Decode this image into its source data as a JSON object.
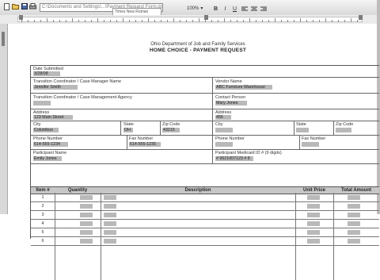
{
  "toolbar": {
    "path_text": "C:\\Documents and Settings\\...\\Payment Request Form.doc",
    "font_name": "Times New Roman",
    "zoom": "100%",
    "buttons": [
      "new-icon",
      "open-icon",
      "save-icon",
      "print-icon",
      "cut-icon",
      "copy-icon",
      "paste-icon",
      "undo-icon"
    ],
    "right_buttons": [
      "bold-icon",
      "italic-icon",
      "underline-icon",
      "align-left-icon",
      "align-center-icon",
      "align-right-icon",
      "bullets-icon",
      "indent-icon"
    ]
  },
  "document": {
    "agency_line": "Ohio Department of Job and Family Services",
    "title": "HOME CHOICE - PAYMENT REQUEST",
    "date_submitted_label": "Date Submitted",
    "date_submitted_value": "3/28/08",
    "coordinator_label": "Transition Coordinator / Case Manager Name",
    "coordinator_value": "Jennifer Smith",
    "vendor_name_label": "Vendor Name",
    "vendor_name_value": "ABC Furniture Warehouse",
    "agency_label": "Transition Coordinator / Case Management Agency",
    "agency_value": "",
    "contact_label": "Contact Person",
    "contact_value": "Mary Jones",
    "address_left_label": "Address",
    "address_left_value": "123 Main Street",
    "address_right_label": "Address",
    "address_right_value": "456",
    "city_label": "City",
    "city_left_value": "Columbus",
    "state_label": "State",
    "state_left_value": "OH",
    "zip_label": "Zip Code",
    "zip_left_value": "43215",
    "city_right_value": "",
    "state_right_value": "",
    "zip_right_value": "",
    "phone_label": "Phone Number",
    "phone_left_value": "614-555-1234",
    "fax_label": "Fax Number",
    "fax_left_value": "614-555-1235",
    "phone_right_value": "",
    "fax_right_value": "",
    "participant_name_label": "Participant Name",
    "participant_name_value": "Emily Jones",
    "participant_id_label": "Participant Medicaid ID # (9 digits)",
    "participant_id_value": "# 9621007123 # 8"
  },
  "table": {
    "headers": [
      "Item #",
      "Quantity",
      "Description",
      "Unit Price",
      "Total Amount"
    ],
    "rows": [
      "1",
      "2",
      "3",
      "4",
      "5",
      "6"
    ]
  }
}
